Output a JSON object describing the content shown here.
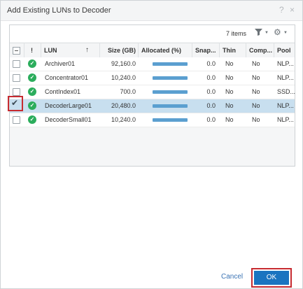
{
  "dialog": {
    "title": "Add Existing LUNs to Decoder",
    "help_icon": "?",
    "close_icon": "×"
  },
  "toolbar": {
    "items_count": "7 items",
    "filter_icon": "filter-icon",
    "settings_icon": "gear-icon"
  },
  "columns": {
    "status": "!",
    "lun": "LUN",
    "size": "Size (GB)",
    "allocated": "Allocated (%)",
    "snap": "Snap...",
    "thin": "Thin",
    "comp": "Comp...",
    "pool": "Pool"
  },
  "rows": [
    {
      "lun": "Archiver01",
      "size": "92,160.0",
      "snap": "0.0",
      "thin": "No",
      "comp": "No",
      "pool": "NLP...",
      "selected": false
    },
    {
      "lun": "Concentrator01",
      "size": "10,240.0",
      "snap": "0.0",
      "thin": "No",
      "comp": "No",
      "pool": "NLP...",
      "selected": false
    },
    {
      "lun": "ContIndex01",
      "size": "700.0",
      "snap": "0.0",
      "thin": "No",
      "comp": "No",
      "pool": "SSD...",
      "selected": false
    },
    {
      "lun": "DecoderLarge01",
      "size": "20,480.0",
      "snap": "0.0",
      "thin": "No",
      "comp": "No",
      "pool": "NLP...",
      "selected": true
    },
    {
      "lun": "DecoderSmall01",
      "size": "10,240.0",
      "snap": "0.0",
      "thin": "No",
      "comp": "No",
      "pool": "NLP...",
      "selected": false
    }
  ],
  "buttons": {
    "cancel": "Cancel",
    "ok": "OK"
  },
  "colors": {
    "accent": "#1a74c0",
    "status_ok": "#2bad5c",
    "selection": "#c8dfef",
    "highlight": "#c62b31"
  }
}
